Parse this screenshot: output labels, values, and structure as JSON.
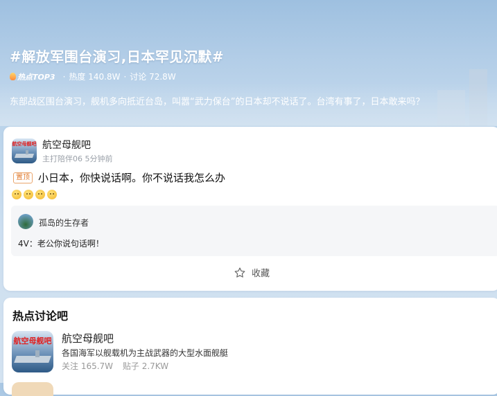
{
  "topic": {
    "title": "#解放军围台演习,日本罕见沉默#",
    "rank_badge": "热点TOP3",
    "heat": "热度 140.8W",
    "discussion": "讨论 72.8W",
    "description": "东部战区围台演习，舰机多向抵近台岛，叫嚣“武力保台”的日本却不说话了。台湾有事了，日本敢来吗？"
  },
  "post": {
    "forum_name": "航空母舰吧",
    "meta": "主打陪伴06 5分钟前",
    "pin_label": "置顶",
    "text": "小日本，你快说话啊。你不说话我怎么办",
    "emoji_count": 4,
    "reply": {
      "user": "孤岛的生存者",
      "text": "4V：老公你说句话啊！"
    },
    "favorite_label": "收藏"
  },
  "hot_section": {
    "title": "热点讨论吧",
    "forum": {
      "name": "航空母舰吧",
      "description": "各国海军以舰载机为主战武器的大型水面舰艇",
      "followers": "关注 165.7W",
      "posts": "贴子 2.7KW"
    }
  },
  "icons": {
    "star": "star-outline-icon",
    "flame": "flame-icon"
  },
  "colors": {
    "pin": "#e07a2c",
    "emoji": "#f3b72c"
  }
}
